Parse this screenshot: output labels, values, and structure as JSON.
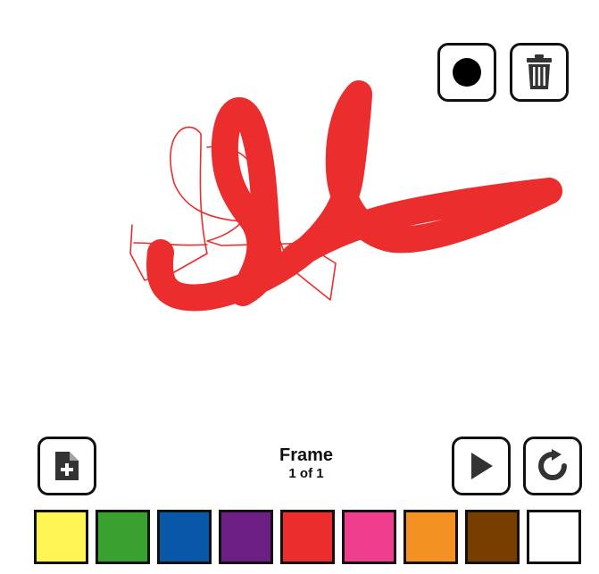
{
  "toolbar": {
    "brush_icon": "brush-dot-icon",
    "trash_icon": "trash-icon"
  },
  "canvas": {
    "stroke_color": "#EC2D2D"
  },
  "frame": {
    "title": "Frame",
    "count": "1 of 1"
  },
  "controls": {
    "new_frame_icon": "new-frame-icon",
    "play_icon": "play-icon",
    "loop_icon": "loop-icon"
  },
  "palette": {
    "colors": [
      {
        "name": "yellow",
        "hex": "#FFF555"
      },
      {
        "name": "green",
        "hex": "#38A12F"
      },
      {
        "name": "blue",
        "hex": "#0957A8"
      },
      {
        "name": "purple",
        "hex": "#6D1E82"
      },
      {
        "name": "red",
        "hex": "#EC2D2D"
      },
      {
        "name": "pink",
        "hex": "#EF3E8E"
      },
      {
        "name": "orange",
        "hex": "#F39122"
      },
      {
        "name": "brown",
        "hex": "#773E00"
      },
      {
        "name": "white",
        "hex": "#FFFFFF"
      }
    ]
  }
}
